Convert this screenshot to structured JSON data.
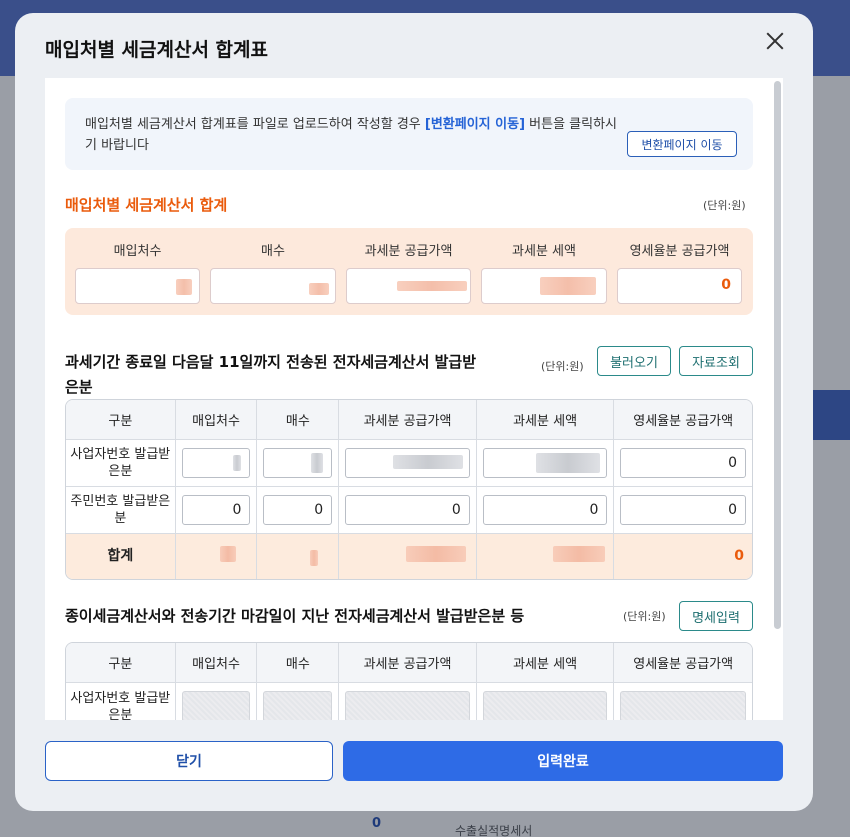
{
  "background": {
    "bottom_text": "수출실적명세서",
    "bottom_value": "0"
  },
  "modal": {
    "title": "매입처별 세금계산서 합계표"
  },
  "info": {
    "text_before": "매입처별 세금계산서 합계표를 파일로 업로드하여 작성할 경우 ",
    "text_highlight": "[변환페이지 이동]",
    "text_after": " 버튼을 클릭하시기 바랍니다",
    "button_label": "변환페이지 이동"
  },
  "summary": {
    "title": "매입처별 세금계산서 합계",
    "unit": "(단위:원)",
    "columns": [
      "매입처수",
      "매수",
      "과세분 공급가액",
      "과세분 세액",
      "영세율분 공급가액"
    ],
    "zero_rate_value": "0"
  },
  "electronic": {
    "title": "과세기간 종료일 다음달 11일까지 전송된 전자세금계산서 발급받은분",
    "unit": "(단위:원)",
    "load_button": "불러오기",
    "query_button": "자료조회",
    "headers": [
      "구분",
      "매입처수",
      "매수",
      "과세분 공급가액",
      "과세분 세액",
      "영세율분 공급가액"
    ],
    "row1_label": "사업자번호 발급받은분",
    "row1_zero_rate": "0",
    "row2_label": "주민번호 발급받은분",
    "row2_values": [
      "0",
      "0",
      "0",
      "0",
      "0"
    ],
    "total_label": "합계",
    "total_zero_rate": "0"
  },
  "paper": {
    "title": "종이세금계산서와 전송기간 마감일이 지난 전자세금계산서 발급받은분 등",
    "unit": "(단위:원)",
    "detail_button": "명세입력",
    "headers": [
      "구분",
      "매입처수",
      "매수",
      "과세분 공급가액",
      "과세분 세액",
      "영세율분 공급가액"
    ],
    "row1_label": "사업자번호 발급받은분"
  },
  "footer": {
    "close_label": "닫기",
    "submit_label": "입력완료"
  }
}
